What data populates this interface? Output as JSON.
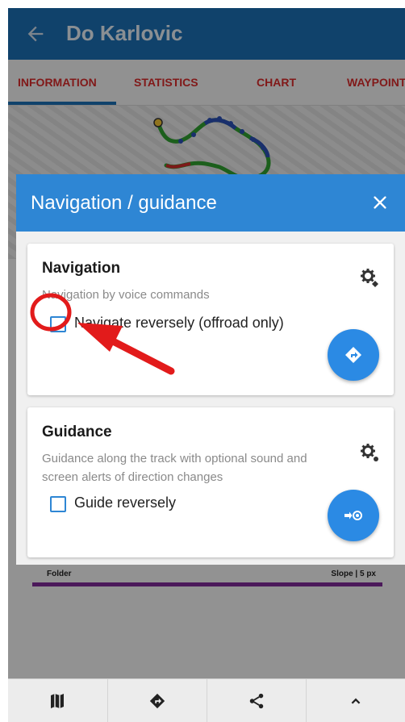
{
  "appbar": {
    "title": "Do Karlovic"
  },
  "tabs": [
    {
      "label": "INFORMATION"
    },
    {
      "label": "STATISTICS"
    },
    {
      "label": "CHART"
    },
    {
      "label": "WAYPOINT"
    }
  ],
  "track_info": {
    "folder_label": "Folder",
    "slope_label": "Slope | 5 px"
  },
  "dialog": {
    "title": "Navigation / guidance",
    "close_icon": "close-icon",
    "navigation": {
      "title": "Navigation",
      "description": "Navigation by voice commands",
      "checkbox_label": "Navigate reversely (offroad only)",
      "checked": false,
      "settings_icon": "settings-gear-icon",
      "fab_icon": "navigate-diamond-icon"
    },
    "guidance": {
      "title": "Guidance",
      "description": "Guidance along the track with optional sound and screen alerts of direction changes",
      "checkbox_label": "Guide reversely",
      "checked": false,
      "settings_icon": "settings-gear-icon",
      "fab_icon": "guide-arrow-target-icon"
    }
  },
  "bottom_nav": [
    {
      "icon": "map-icon"
    },
    {
      "icon": "navigate-icon"
    },
    {
      "icon": "share-icon"
    },
    {
      "icon": "chevron-up-icon"
    }
  ],
  "colors": {
    "appbar": "#1c6fb3",
    "dialog_header": "#2e86d4",
    "fab": "#2b8ae4",
    "tab_text": "#d72b2b",
    "annotation": "#e21b1b"
  }
}
